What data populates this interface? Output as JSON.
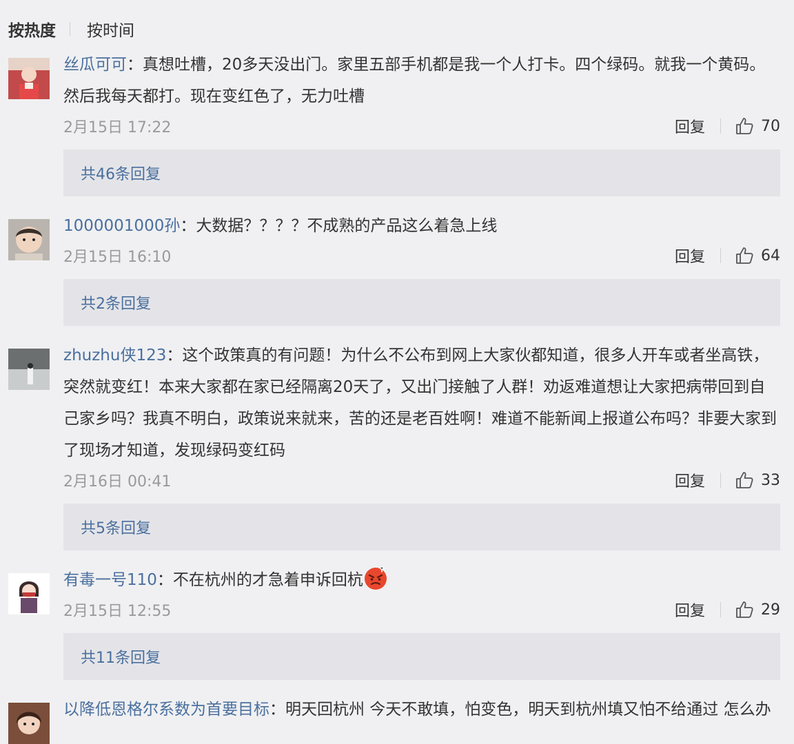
{
  "sort": {
    "hot_label": "按热度",
    "time_label": "按时间"
  },
  "comments": [
    {
      "user": "丝瓜可可",
      "colon": "：",
      "text": "真想吐槽，20多天没出门。家里五部手机都是我一个人打卡。四个绿码。就我一个黄码。然后我每天都打。现在变红色了，无力吐槽",
      "time": "2月15日 17:22",
      "reply_label": "回复",
      "likes": "70",
      "replies_link": "共46条回复"
    },
    {
      "user": "1000001000孙",
      "colon": "：",
      "text": "大数据？？？？不成熟的产品这么着急上线",
      "time": "2月15日 16:10",
      "reply_label": "回复",
      "likes": "64",
      "replies_link": "共2条回复"
    },
    {
      "user": "zhuzhu侠123",
      "colon": "：",
      "text": "这个政策真的有问题！为什么不公布到网上大家伙都知道，很多人开车或者坐高铁，突然就变红！本来大家都在家已经隔离20天了，又出门接触了人群！劝返难道想让大家把病带回到自己家乡吗？我真不明白，政策说来就来，苦的还是老百姓啊！难道不能新闻上报道公布吗？非要大家到了现场才知道，发现绿码变红码",
      "time": "2月16日 00:41",
      "reply_label": "回复",
      "likes": "33",
      "replies_link": "共5条回复"
    },
    {
      "user": "有毒一号110",
      "colon": "：",
      "text": "不在杭州的才急着申诉回杭",
      "emoji": "angry-face-emoji",
      "time": "2月15日 12:55",
      "reply_label": "回复",
      "likes": "29",
      "replies_link": "共11条回复"
    },
    {
      "user": "以降低恩格尔系数为首要目标",
      "colon": "：",
      "text": "明天回杭州 今天不敢填，怕变色，明天到杭州填又怕不给通过  怎么办"
    }
  ],
  "colors": {
    "username": "#4a6f9e",
    "background": "#f0f0f2",
    "reply_box": "#e4e4e8"
  }
}
